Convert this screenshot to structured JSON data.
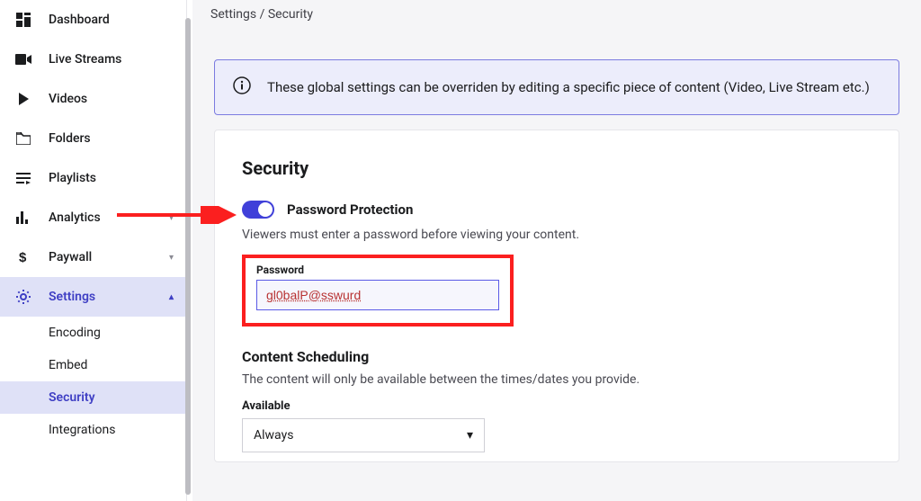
{
  "breadcrumb": {
    "parent": "Settings",
    "sep": " / ",
    "current": "Security"
  },
  "sidebar": {
    "items": [
      {
        "label": "Dashboard"
      },
      {
        "label": "Live Streams"
      },
      {
        "label": "Videos"
      },
      {
        "label": "Folders"
      },
      {
        "label": "Playlists"
      },
      {
        "label": "Analytics"
      },
      {
        "label": "Paywall"
      },
      {
        "label": "Settings"
      }
    ],
    "subitems": {
      "encoding": "Encoding",
      "embed": "Embed",
      "security": "Security",
      "integrations": "Integrations"
    }
  },
  "notice": {
    "text": "These global settings can be overriden by editing a specific piece of content (Video, Live Stream etc.)"
  },
  "security": {
    "title": "Security",
    "password_protection": {
      "label": "Password Protection",
      "helper": "Viewers must enter a password before viewing your content.",
      "field_label": "Password",
      "value": "gl0balP@sswurd"
    },
    "content_scheduling": {
      "title": "Content Scheduling",
      "helper": "The content will only be available between the times/dates you provide.",
      "available_label": "Available",
      "available_value": "Always"
    }
  }
}
